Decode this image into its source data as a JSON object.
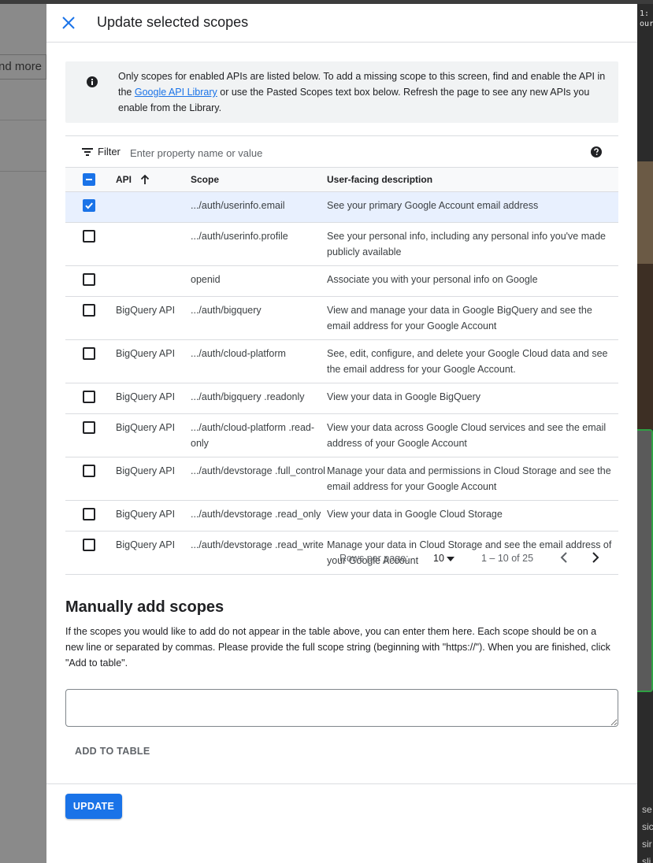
{
  "background": {
    "left_button_text": "nd more",
    "terminal_lines": [
      "1:",
      "our"
    ],
    "bottom_lines": [
      "se",
      "sic",
      "sir",
      "sli"
    ]
  },
  "dialog": {
    "title": "Update selected scopes",
    "close_icon": "close-icon"
  },
  "info": {
    "icon": "info-icon",
    "text_before_link": "Only scopes for enabled APIs are listed below. To add a missing scope to this screen, find and enable the API in the ",
    "link_text": "Google API Library",
    "text_after_link": " or use the Pasted Scopes text box below. Refresh the page to see any new APIs you enable from the Library."
  },
  "filter": {
    "label": "Filter",
    "placeholder": "Enter property name or value",
    "icon": "filter-icon",
    "help_icon": "help-icon"
  },
  "table": {
    "headers": {
      "api": "API",
      "scope": "Scope",
      "description": "User-facing description"
    },
    "header_checkbox": "indeterminate",
    "sort": "ascending",
    "rows": [
      {
        "checked": true,
        "api": "",
        "scope": ".../auth/userinfo.email",
        "description": "See your primary Google Account email address"
      },
      {
        "checked": false,
        "api": "",
        "scope": ".../auth/userinfo.profile",
        "description": "See your personal info, including any personal info you've made publicly available"
      },
      {
        "checked": false,
        "api": "",
        "scope": "openid",
        "description": "Associate you with your personal info on Google"
      },
      {
        "checked": false,
        "api": "BigQuery API",
        "scope": ".../auth/bigquery",
        "description": "View and manage your data in Google BigQuery and see the email address for your Google Account"
      },
      {
        "checked": false,
        "api": "BigQuery API",
        "scope": ".../auth/cloud-platform",
        "description": "See, edit, configure, and delete your Google Cloud data and see the email address for your Google Account."
      },
      {
        "checked": false,
        "api": "BigQuery API",
        "scope": ".../auth/bigquery .readonly",
        "description": "View your data in Google BigQuery"
      },
      {
        "checked": false,
        "api": "BigQuery API",
        "scope": ".../auth/cloud-platform .read-only",
        "description": "View your data across Google Cloud services and see the email address of your Google Account"
      },
      {
        "checked": false,
        "api": "BigQuery API",
        "scope": ".../auth/devstorage .full_control",
        "description": "Manage your data and permissions in Cloud Storage and see the email address for your Google Account"
      },
      {
        "checked": false,
        "api": "BigQuery API",
        "scope": ".../auth/devstorage .read_only",
        "description": "View your data in Google Cloud Storage"
      },
      {
        "checked": false,
        "api": "BigQuery API",
        "scope": ".../auth/devstorage .read_write",
        "description": "Manage your data in Cloud Storage and see the email address of your Google Account"
      }
    ]
  },
  "pagination": {
    "rows_label": "Rows per page:",
    "rows_value": "10",
    "range": "1 – 10 of 25"
  },
  "manual": {
    "title": "Manually add scopes",
    "description": "If the scopes you would like to add do not appear in the table above, you can enter them here. Each scope should be on a new line or separated by commas. Please provide the full scope string (beginning with \"https://\"). When you are finished, click \"Add to table\".",
    "input_value": "",
    "add_button": "ADD TO TABLE"
  },
  "footer": {
    "update_button": "UPDATE"
  },
  "colors": {
    "primary": "#1a73e8",
    "selected_row": "#e8f0fe",
    "info_bg": "#f1f3f4"
  }
}
